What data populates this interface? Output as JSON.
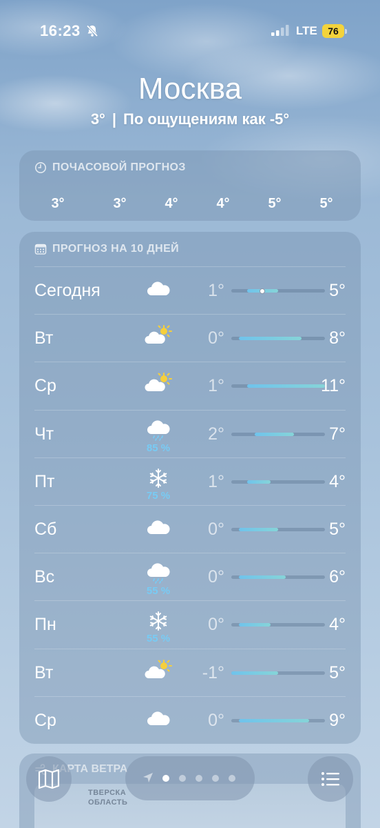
{
  "status_bar": {
    "time": "16:23",
    "network": "LTE",
    "battery": "76"
  },
  "location": {
    "city": "Москва",
    "current_temp": "3°",
    "separator": "|",
    "feels_like": "По ощущениям как -5°"
  },
  "hourly": {
    "title": "ПОЧАСОВОЙ ПРОГНОЗ",
    "temps": [
      "3°",
      "3°",
      "4°",
      "4°",
      "5°",
      "5°"
    ]
  },
  "daily": {
    "title": "ПРОГНОЗ НА 10 ДНЕЙ",
    "days": [
      {
        "name": "Сегодня",
        "icon": "cloud-icon",
        "precip": "",
        "low": "1°",
        "high": "5°",
        "low_value": 1,
        "high_value": 5,
        "current": 3
      },
      {
        "name": "Вт",
        "icon": "partly-sunny-icon",
        "precip": "",
        "low": "0°",
        "high": "8°",
        "low_value": 0,
        "high_value": 8
      },
      {
        "name": "Ср",
        "icon": "partly-sunny-icon",
        "precip": "",
        "low": "1°",
        "high": "11°",
        "low_value": 1,
        "high_value": 11
      },
      {
        "name": "Чт",
        "icon": "rain-cloud-icon",
        "precip": "85 %",
        "low": "2°",
        "high": "7°",
        "low_value": 2,
        "high_value": 7
      },
      {
        "name": "Пт",
        "icon": "snowflake-icon",
        "precip": "75 %",
        "low": "1°",
        "high": "4°",
        "low_value": 1,
        "high_value": 4
      },
      {
        "name": "Сб",
        "icon": "cloud-icon",
        "precip": "",
        "low": "0°",
        "high": "5°",
        "low_value": 0,
        "high_value": 5
      },
      {
        "name": "Вс",
        "icon": "rain-cloud-icon",
        "precip": "55 %",
        "low": "0°",
        "high": "6°",
        "low_value": 0,
        "high_value": 6
      },
      {
        "name": "Пн",
        "icon": "snowflake-icon",
        "precip": "55 %",
        "low": "0°",
        "high": "4°",
        "low_value": 0,
        "high_value": 4
      },
      {
        "name": "Вт",
        "icon": "partly-sunny-icon",
        "precip": "",
        "low": "-1°",
        "high": "5°",
        "low_value": -1,
        "high_value": 5
      },
      {
        "name": "Ср",
        "icon": "cloud-icon",
        "precip": "",
        "low": "0°",
        "high": "9°",
        "low_value": 0,
        "high_value": 9
      }
    ],
    "scale_min": -1,
    "scale_max": 11
  },
  "wind_map": {
    "title": "КАРТА ВЕТРА",
    "region_label_1": "ТВЕРСКА",
    "region_label_2": "ОБЛАСТЬ"
  },
  "bottom_bar": {
    "pages": 5,
    "active_page": 0
  },
  "colors": {
    "accent_bar": "#6fc3ec",
    "precip_text": "#78cbf4",
    "battery": "#f3d33b"
  }
}
